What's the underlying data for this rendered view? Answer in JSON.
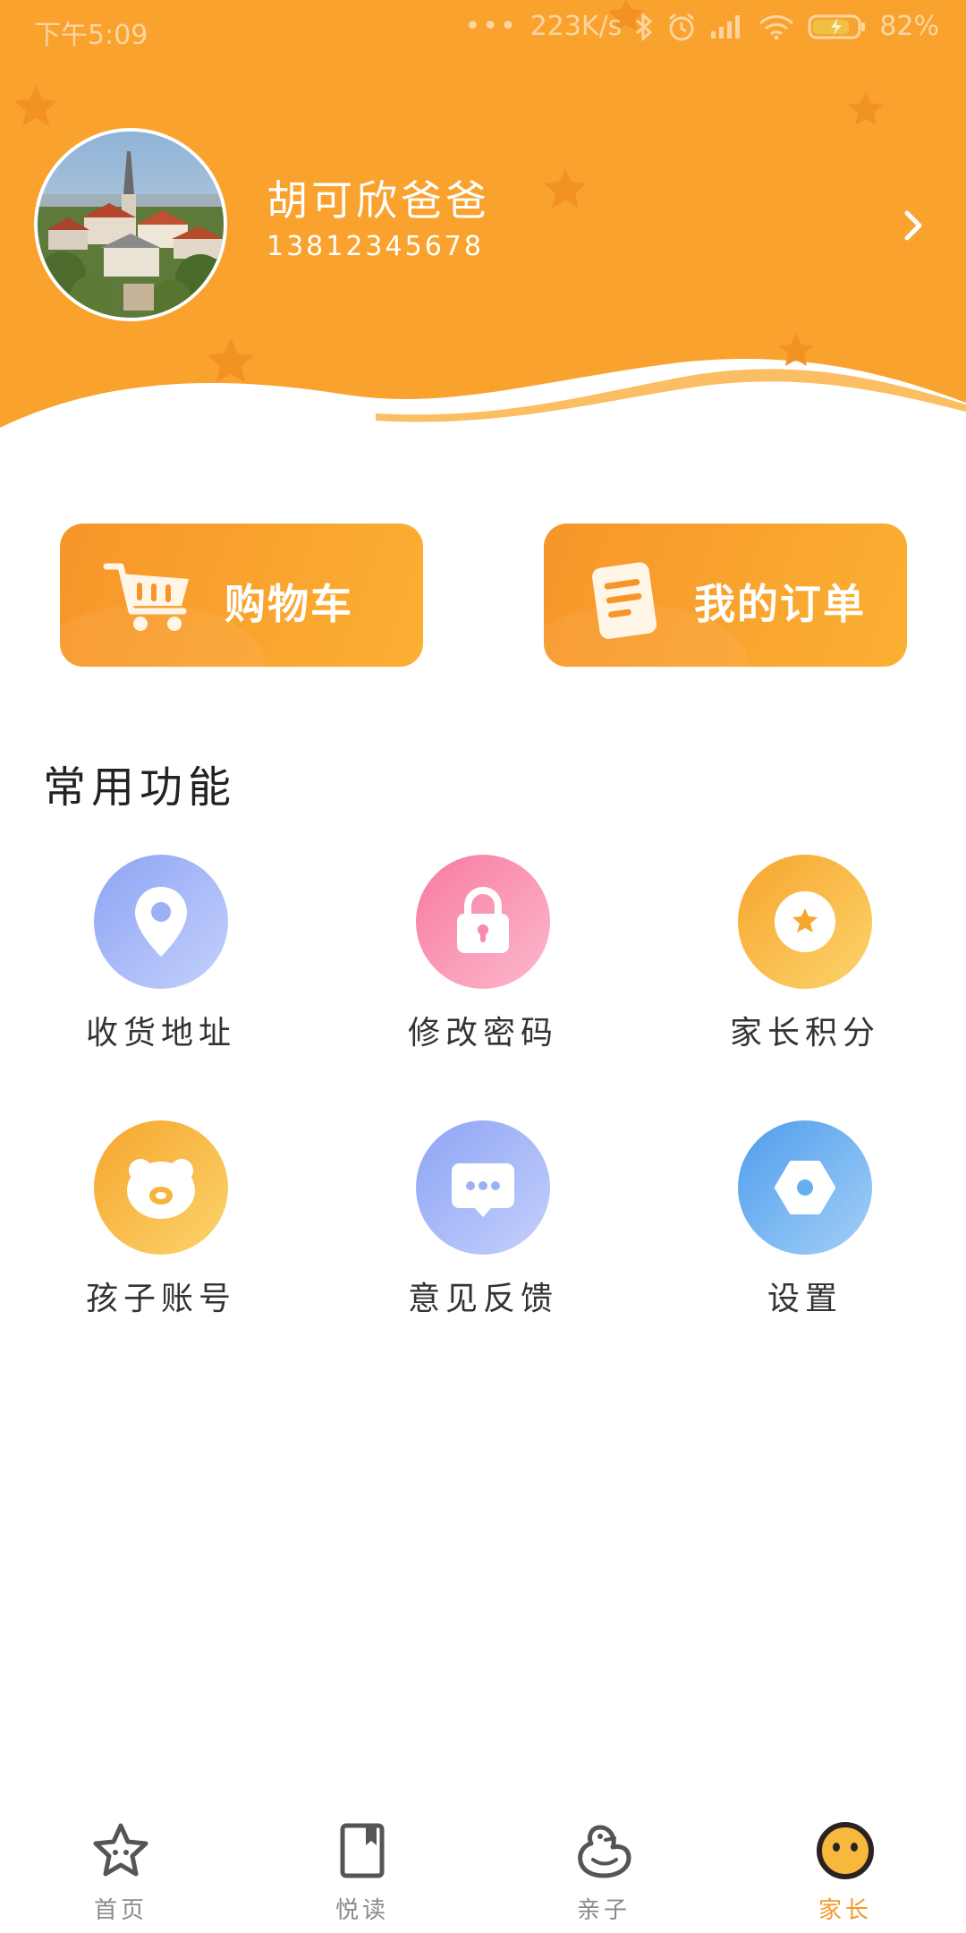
{
  "status_bar": {
    "time": "下午5:09",
    "network_speed": "223K/s",
    "battery": "82%"
  },
  "header": {
    "user_name": "胡可欣爸爸",
    "phone": "13812345678",
    "arrow_icon": "chevron-right-icon"
  },
  "quick_actions": [
    {
      "label": "购物车",
      "icon": "cart-icon"
    },
    {
      "label": "我的订单",
      "icon": "order-icon"
    }
  ],
  "section": {
    "title": "常用功能"
  },
  "features": [
    {
      "label": "收货地址",
      "icon": "location-pin-icon",
      "color": "#8ea4f5"
    },
    {
      "label": "修改密码",
      "icon": "lock-icon",
      "color": "#f87aa0"
    },
    {
      "label": "家长积分",
      "icon": "star-badge-icon",
      "color": "#f7a52d"
    },
    {
      "label": "孩子账号",
      "icon": "bear-icon",
      "color": "#f7a52d"
    },
    {
      "label": "意见反馈",
      "icon": "chat-bubble-icon",
      "color": "#8ea4f5"
    },
    {
      "label": "设置",
      "icon": "hexagon-nut-icon",
      "color": "#4f9ded"
    }
  ],
  "bottom_nav": [
    {
      "label": "首页",
      "icon": "star-icon",
      "active": false
    },
    {
      "label": "悦读",
      "icon": "book-icon",
      "active": false
    },
    {
      "label": "亲子",
      "icon": "duck-icon",
      "active": false
    },
    {
      "label": "家长",
      "icon": "face-icon",
      "active": true
    }
  ],
  "colors": {
    "brand_orange": "#f9a22e",
    "active_nav": "#f39a2c",
    "inactive_nav": "#8a8a8a"
  }
}
